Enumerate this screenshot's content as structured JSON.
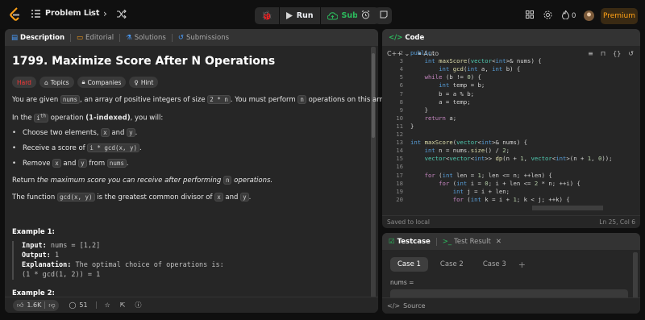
{
  "header": {
    "problem_list": "Problem List",
    "run": "Run",
    "submit": "Submit",
    "coins": "0",
    "premium": "Premium",
    "accent": "#ffa116",
    "submit_color": "#2cbb5d"
  },
  "left_tabs": [
    "Description",
    "Editorial",
    "Solutions",
    "Submissions"
  ],
  "problem": {
    "title": "1799. Maximize Score After N Operations",
    "tags": [
      "Hard",
      "Topics",
      "Companies",
      "Hint"
    ],
    "intro_1": "You are given ",
    "intro_code1": "nums",
    "intro_2": ", an array of positive integers of size ",
    "intro_code2": "2 * n",
    "intro_3": ". You must perform ",
    "intro_code3": "n",
    "intro_4": " operations on this array.",
    "op_1": "In the ",
    "op_code": "i",
    "op_sup": "th",
    "op_2": " operation ",
    "op_bold": "(1-indexed)",
    "op_3": ", you will:",
    "b1_a": "Choose two elements, ",
    "b1_c1": "x",
    "b1_b": " and ",
    "b1_c2": "y",
    "b1_c": ".",
    "b2_a": "Receive a score of ",
    "b2_c": "i * gcd(x, y)",
    "b2_b": ".",
    "b3_a": "Remove ",
    "b3_c1": "x",
    "b3_b": " and ",
    "b3_c2": "y",
    "b3_c": " from ",
    "b3_c3": "nums",
    "b3_d": ".",
    "ret_1": "Return ",
    "ret_i": "the maximum score you can receive after performing ",
    "ret_code": "n",
    "ret_2": " operations.",
    "fn_1": "The function ",
    "fn_code": "gcd(x, y)",
    "fn_2": " is the greatest common divisor of ",
    "fn_c1": "x",
    "fn_3": " and ",
    "fn_c2": "y",
    "fn_4": ".",
    "ex1_title": "Example 1:",
    "ex1_input_label": "Input:",
    "ex1_input": " nums = [1,2]",
    "ex1_output_label": "Output:",
    "ex1_output": " 1",
    "ex1_expl_label": "Explanation:",
    "ex1_expl": " The optimal choice of operations is:",
    "ex1_expl2": "(1 * gcd(1, 2)) = 1",
    "ex2_title": "Example 2:"
  },
  "footer": {
    "likes": "1.6K",
    "comments": "51"
  },
  "code_panel": {
    "title": "Code",
    "language": "C++",
    "auto": "Auto",
    "status": "Saved to local",
    "position": "Ln 25, Col 6"
  },
  "code_lines": [
    {
      "n": "2",
      "t": "public:"
    },
    {
      "n": "3",
      "t": "    int maxScore(vector<int>& nums) {"
    },
    {
      "n": "4",
      "t": "        int gcd(int a, int b) {"
    },
    {
      "n": "5",
      "t": "    while (b != 0) {"
    },
    {
      "n": "6",
      "t": "        int temp = b;"
    },
    {
      "n": "7",
      "t": "        b = a % b;"
    },
    {
      "n": "8",
      "t": "        a = temp;"
    },
    {
      "n": "9",
      "t": "    }"
    },
    {
      "n": "10",
      "t": "    return a;"
    },
    {
      "n": "11",
      "t": "}"
    },
    {
      "n": "12",
      "t": ""
    },
    {
      "n": "13",
      "t": "int maxScore(vector<int>& nums) {"
    },
    {
      "n": "14",
      "t": "    int n = nums.size() / 2;"
    },
    {
      "n": "15",
      "t": "    vector<vector<int>> dp(n + 1, vector<int>(n + 1, 0));"
    },
    {
      "n": "16",
      "t": ""
    },
    {
      "n": "17",
      "t": "    for (int len = 1; len <= n; ++len) {"
    },
    {
      "n": "18",
      "t": "        for (int i = 0; i + len <= 2 * n; ++i) {"
    },
    {
      "n": "19",
      "t": "            int j = i + len;"
    },
    {
      "n": "20",
      "t": "            for (int k = i + 1; k < j; ++k) {"
    }
  ],
  "testcase": {
    "tab1": "Testcase",
    "tab2": "Test Result",
    "cases": [
      "Case 1",
      "Case 2",
      "Case 3"
    ],
    "var_label": "nums =",
    "source": "Source"
  }
}
